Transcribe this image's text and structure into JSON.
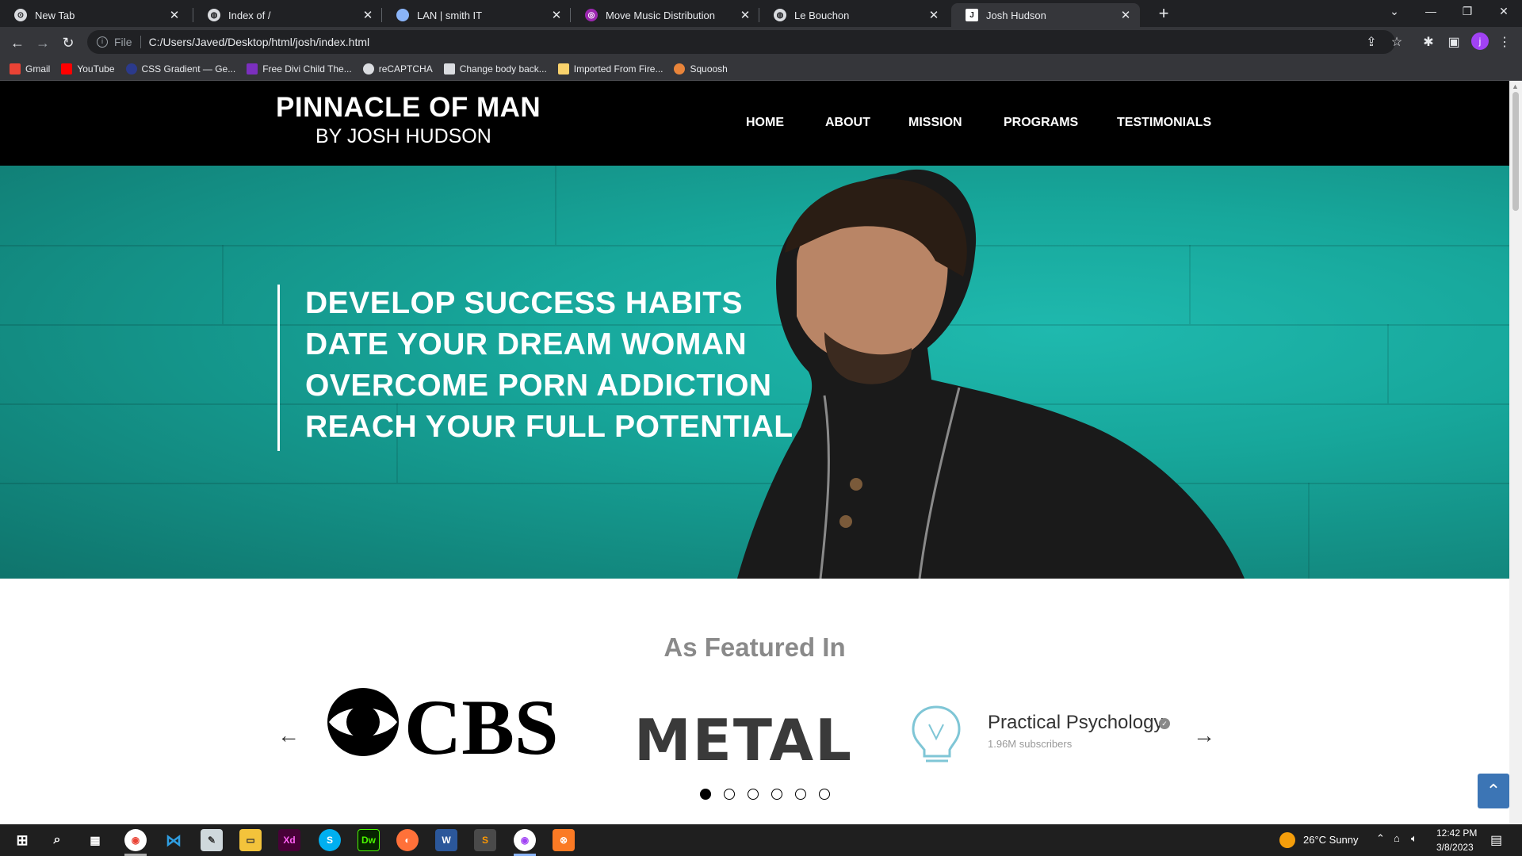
{
  "browser": {
    "tabs": [
      {
        "title": "New Tab",
        "icon": "chrome-icon"
      },
      {
        "title": "Index of /",
        "icon": "globe-icon"
      },
      {
        "title": "LAN | smith IT",
        "icon": "lan-icon"
      },
      {
        "title": "Move Music Distribution",
        "icon": "music-icon"
      },
      {
        "title": "Le Bouchon",
        "icon": "globe-icon"
      },
      {
        "title": "Josh Hudson",
        "icon": "j-icon"
      }
    ],
    "address": {
      "scheme": "File",
      "url": "C:/Users/Javed/Desktop/html/josh/index.html"
    },
    "profile_initial": "j",
    "bookmarks": [
      "Gmail",
      "YouTube",
      "CSS Gradient — Ge...",
      "Free Divi Child The...",
      "reCAPTCHA",
      "Change body back...",
      "Imported From Fire...",
      "Squoosh"
    ]
  },
  "site": {
    "brand_title": "PINNACLE OF MAN",
    "brand_subtitle": "BY JOSH HUDSON",
    "nav": [
      "HOME",
      "ABOUT",
      "MISSION",
      "PROGRAMS",
      "TESTIMONIALS"
    ],
    "hero_lines": [
      "DEVELOP SUCCESS HABITS",
      "DATE YOUR DREAM WOMAN",
      "OVERCOME PORN ADDICTION",
      "REACH YOUR FULL POTENTIAL"
    ],
    "featured_title": "As Featured In",
    "logos": {
      "cbs": "CBS",
      "metal": "METAL",
      "pp_name": "Practical Psychology",
      "pp_subs": "1.96M subscribers"
    },
    "carousel_dots": 6,
    "carousel_active": 1,
    "prev_arrow": "←",
    "next_arrow": "→"
  },
  "taskbar": {
    "weather": "26°C  Sunny",
    "time": "12:42 PM",
    "date": "3/8/2023"
  },
  "colors": {
    "hero": "#17a79b",
    "header": "#000000",
    "back_to_top": "#3c75b5"
  }
}
